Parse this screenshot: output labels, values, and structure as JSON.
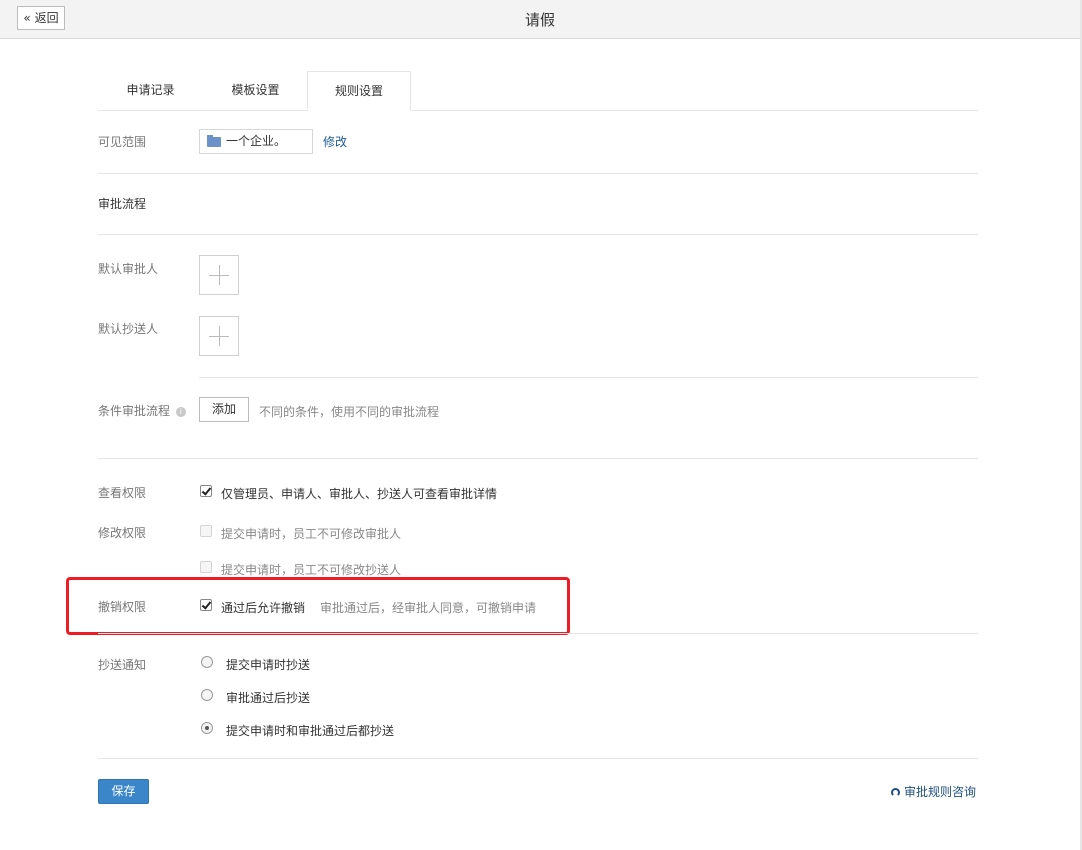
{
  "header": {
    "back_label": "返回",
    "title": "请假"
  },
  "tabs": [
    {
      "label": "申请记录",
      "active": false
    },
    {
      "label": "模板设置",
      "active": false
    },
    {
      "label": "规则设置",
      "active": true
    }
  ],
  "scope": {
    "label": "可见范围",
    "value": "一个企业。",
    "edit_label": "修改"
  },
  "flow": {
    "section_title": "审批流程",
    "default_approver_label": "默认审批人",
    "default_cc_label": "默认抄送人",
    "conditional_label": "条件审批流程",
    "add_button_label": "添加",
    "conditional_hint": "不同的条件，使用不同的审批流程"
  },
  "permissions": {
    "view_label": "查看权限",
    "view_option": "仅管理员、申请人、审批人、抄送人可查看审批详情",
    "edit_label": "修改权限",
    "edit_option_1": "提交申请时，员工不可修改审批人",
    "edit_option_2": "提交申请时，员工不可修改抄送人",
    "revoke_label": "撤销权限",
    "revoke_option": "通过后允许撤销",
    "revoke_hint": "审批通过后，经审批人同意，可撤销申请"
  },
  "cc_notify": {
    "label": "抄送通知",
    "options": [
      "提交申请时抄送",
      "审批通过后抄送",
      "提交申请时和审批通过后都抄送"
    ],
    "selected_index": 2
  },
  "footer": {
    "save_label": "保存",
    "consult_label": "审批规则咨询"
  },
  "colors": {
    "accent": "#3a86c9",
    "link": "#1e5c99",
    "highlight": "#ee1c24"
  }
}
